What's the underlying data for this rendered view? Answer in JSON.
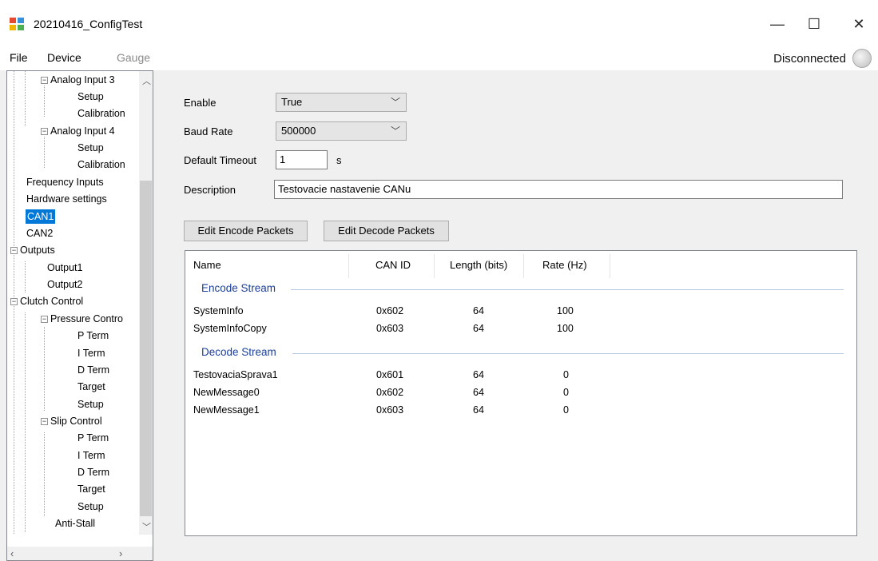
{
  "window": {
    "title": "20210416_ConfigTest",
    "minimize": "—",
    "maximize": "☐",
    "close": "✕"
  },
  "menu": {
    "file": "File",
    "device": "Device",
    "gauge": "Gauge"
  },
  "status": {
    "connection": "Disconnected"
  },
  "tree": {
    "items": [
      {
        "label": "Analog Input 3"
      },
      {
        "label": "Setup"
      },
      {
        "label": "Calibration"
      },
      {
        "label": "Analog Input 4"
      },
      {
        "label": "Setup"
      },
      {
        "label": "Calibration"
      },
      {
        "label": "Frequency Inputs"
      },
      {
        "label": "Hardware settings"
      },
      {
        "label": "CAN1"
      },
      {
        "label": "CAN2"
      },
      {
        "label": "Outputs"
      },
      {
        "label": "Output1"
      },
      {
        "label": "Output2"
      },
      {
        "label": "Clutch Control"
      },
      {
        "label": "Pressure Contro"
      },
      {
        "label": "P Term"
      },
      {
        "label": "I Term"
      },
      {
        "label": "D Term"
      },
      {
        "label": "Target"
      },
      {
        "label": "Setup"
      },
      {
        "label": "Slip Control"
      },
      {
        "label": "P Term"
      },
      {
        "label": "I Term"
      },
      {
        "label": "D Term"
      },
      {
        "label": "Target"
      },
      {
        "label": "Setup"
      },
      {
        "label": "Anti-Stall"
      }
    ]
  },
  "form": {
    "enable_label": "Enable",
    "enable_value": "True",
    "baud_label": "Baud Rate",
    "baud_value": "500000",
    "timeout_label": "Default Timeout",
    "timeout_value": "1",
    "timeout_unit": "s",
    "description_label": "Description",
    "description_value": "Testovacie nastavenie CANu",
    "edit_encode_button": "Edit Encode Packets",
    "edit_decode_button": "Edit Decode Packets"
  },
  "list": {
    "columns": [
      "Name",
      "CAN ID",
      "Length (bits)",
      "Rate (Hz)"
    ],
    "groups": [
      {
        "title": "Encode Stream",
        "rows": [
          [
            "SystemInfo",
            "0x602",
            "64",
            "100"
          ],
          [
            "SystemInfoCopy",
            "0x603",
            "64",
            "100"
          ]
        ]
      },
      {
        "title": "Decode Stream",
        "rows": [
          [
            "TestovaciaSprava1",
            "0x601",
            "64",
            "0"
          ],
          [
            "NewMessage0",
            "0x602",
            "64",
            "0"
          ],
          [
            "NewMessage1",
            "0x603",
            "64",
            "0"
          ]
        ]
      }
    ]
  },
  "colors": {
    "selection": "#0078d7",
    "group_header": "#1e3f9a"
  }
}
